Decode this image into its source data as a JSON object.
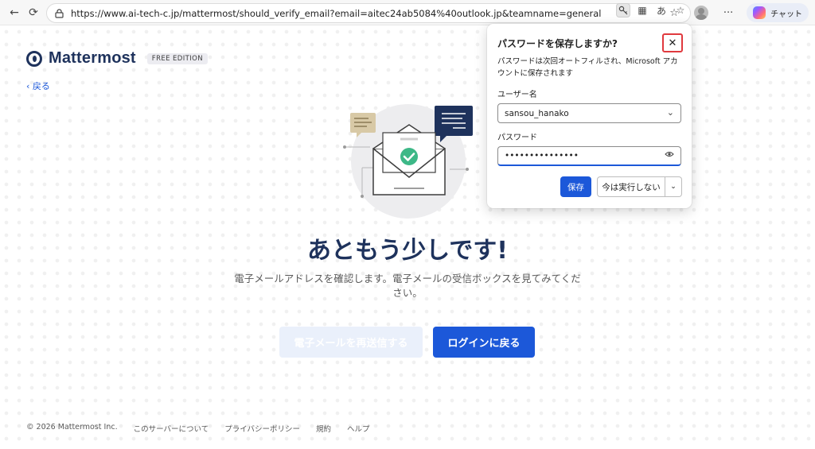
{
  "browser": {
    "url": "https://www.ai-tech-c.jp/mattermost/should_verify_email?email=aitec24ab5084%40outlook.jp&teamname=general",
    "chat_label": "チャット",
    "icons": [
      "back-icon",
      "refresh-icon",
      "lock-icon",
      "key-icon",
      "grid-icon",
      "read-aloud-icon",
      "favorite-icon",
      "favorites-icon",
      "profile-icon",
      "more-icon",
      "copilot-icon"
    ]
  },
  "page": {
    "brand": "Mattermost",
    "edition": "FREE EDITION",
    "back_label": "‹ 戻る",
    "headline": "あともう少しです!",
    "subtext": "電子メールアドレスを確認します。電子メールの受信ボックスを見てみてください。",
    "resend_label": "電子メールを再送信する",
    "login_label": "ログインに戻る",
    "footer": {
      "copyright": "© 2026 Mattermost Inc.",
      "about": "このサーバーについて",
      "privacy": "プライバシーポリシー",
      "terms": "規約",
      "help": "ヘルプ"
    }
  },
  "popup": {
    "title": "パスワードを保存しますか?",
    "description": "パスワードは次回オートフィルされ、Microsoft アカウントに保存されます",
    "username_label": "ユーザー名",
    "username_value": "sansou_hanako",
    "password_label": "パスワード",
    "password_value": "•••••••••••••••",
    "save_label": "保存",
    "not_now_label": "今は実行しない"
  },
  "colors": {
    "brand_navy": "#1e325c",
    "primary_blue": "#1c58d9",
    "check_green": "#3db887",
    "close_highlight": "#e0393e"
  }
}
